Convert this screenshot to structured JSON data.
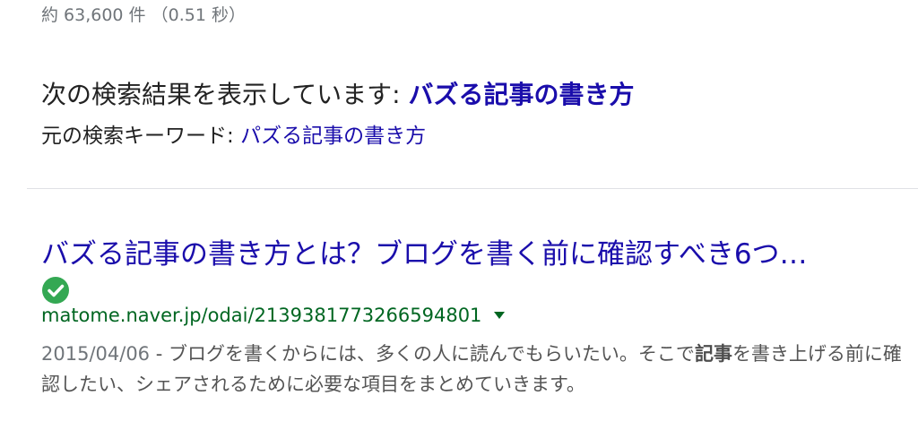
{
  "stats": {
    "text": "約 63,600 件 （0.51 秒）"
  },
  "spelling": {
    "showing_prefix": "次の検索結果を表示しています: ",
    "corrected_query": "バズる記事の書き方",
    "original_prefix": "元の検索キーワード: ",
    "original_query": "パズる記事の書き方"
  },
  "result": {
    "title": "バズる記事の書き方とは？ブログを書く前に確認すべき6つ…",
    "verified_icon": "check-circle-icon",
    "url": "matome.naver.jp/odai/2139381773266594801",
    "date": "2015/04/06",
    "snippet_part1": " - ブログを書くからには、多くの人に読んでもらいたい。そこで",
    "snippet_bold": "記事",
    "snippet_part2": "を書き上げる前に確認したい、シェアされるために必要な項目をまとめていきます。"
  },
  "colors": {
    "link": "#1a0dab",
    "url": "#006621",
    "verified": "#34a853"
  }
}
